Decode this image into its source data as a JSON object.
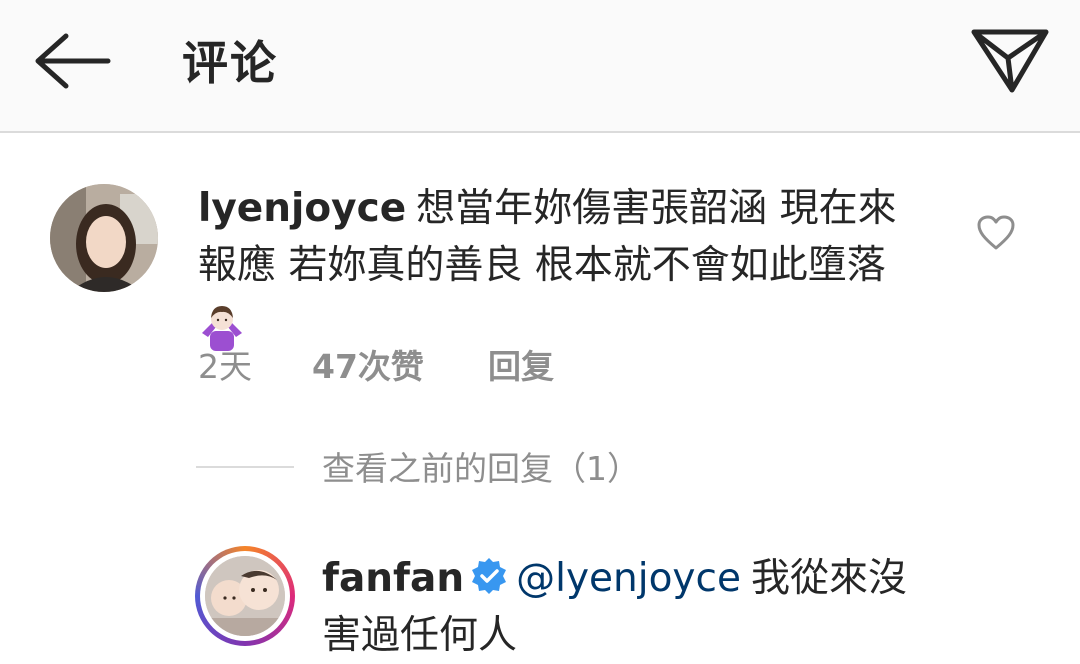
{
  "header": {
    "title": "评论",
    "back_icon": "arrow-left-icon",
    "send_icon": "paper-plane-icon"
  },
  "comment": {
    "username": "lyenjoyce",
    "text_line1": "想當年妳傷害張韶涵 現在來",
    "text_line2": "報應 若妳真的善良 根本就不會如此墮落",
    "emoji": "person-shrugging-emoji",
    "time": "2天",
    "likes": "47次赞",
    "reply_label": "回复",
    "like_icon": "heart-outline-icon"
  },
  "view_replies": {
    "label": "查看之前的回复（1）"
  },
  "reply": {
    "username": "fanfan",
    "verified_icon": "verified-badge-icon",
    "mention": "@lyenjoyce",
    "text_line1": "我從來沒",
    "text_line2": "害過任何人"
  },
  "colors": {
    "text": "#262626",
    "secondary": "#8e8e8e",
    "mention": "#00376b",
    "verified": "#3897f0",
    "header_bg": "#fafafa"
  }
}
